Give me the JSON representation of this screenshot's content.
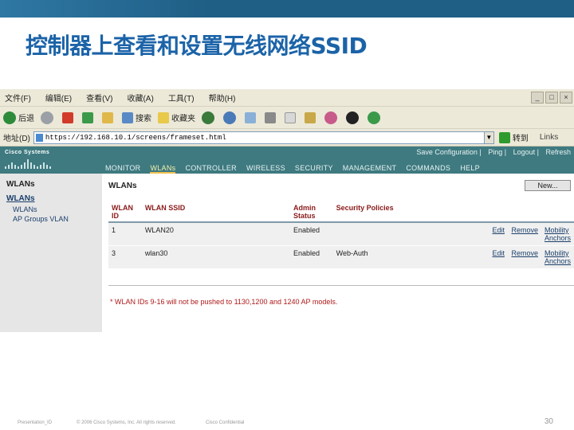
{
  "slide": {
    "title": "控制器上查看和设置无线网络SSID",
    "footer_left": "Presentation_ID",
    "footer_copyright": "© 2006 Cisco Systems, Inc. All rights reserved.",
    "footer_confidential": "Cisco Confidential",
    "page_number": "30"
  },
  "browser": {
    "menu": [
      "文件(F)",
      "编辑(E)",
      "查看(V)",
      "收藏(A)",
      "工具(T)",
      "帮助(H)"
    ],
    "toolbar": {
      "back_label": "后退",
      "search_label": "搜索",
      "favorites_label": "收藏夹"
    },
    "address_label": "地址(D)",
    "address_url": "https://192.168.10.1/screens/frameset.html",
    "go_label": "转到",
    "links_label": "Links"
  },
  "wlc": {
    "brand": "Cisco Systems",
    "top_links": [
      "Save Configuration",
      "Ping",
      "Logout",
      "Refresh"
    ],
    "nav": [
      "MONITOR",
      "WLANs",
      "CONTROLLER",
      "WIRELESS",
      "SECURITY",
      "MANAGEMENT",
      "COMMANDS",
      "HELP"
    ],
    "active_nav": "WLANs",
    "sidebar": {
      "title": "WLANs",
      "section": "WLANs",
      "items": [
        "WLANs",
        "AP Groups VLAN"
      ]
    },
    "page_title": "WLANs",
    "new_button": "New...",
    "table": {
      "headers": [
        "WLAN ID",
        "WLAN SSID",
        "Admin Status",
        "Security Policies"
      ],
      "rows": [
        {
          "id": "1",
          "ssid": "WLAN20",
          "status": "Enabled",
          "policy": "",
          "edit": "Edit",
          "remove": "Remove",
          "mobility": "Mobility Anchors"
        },
        {
          "id": "3",
          "ssid": "wlan30",
          "status": "Enabled",
          "policy": "Web-Auth",
          "edit": "Edit",
          "remove": "Remove",
          "mobility": "Mobility Anchors"
        }
      ]
    },
    "note": "* WLAN IDs 9-16 will not be pushed to 1130,1200 and 1240 AP models."
  }
}
